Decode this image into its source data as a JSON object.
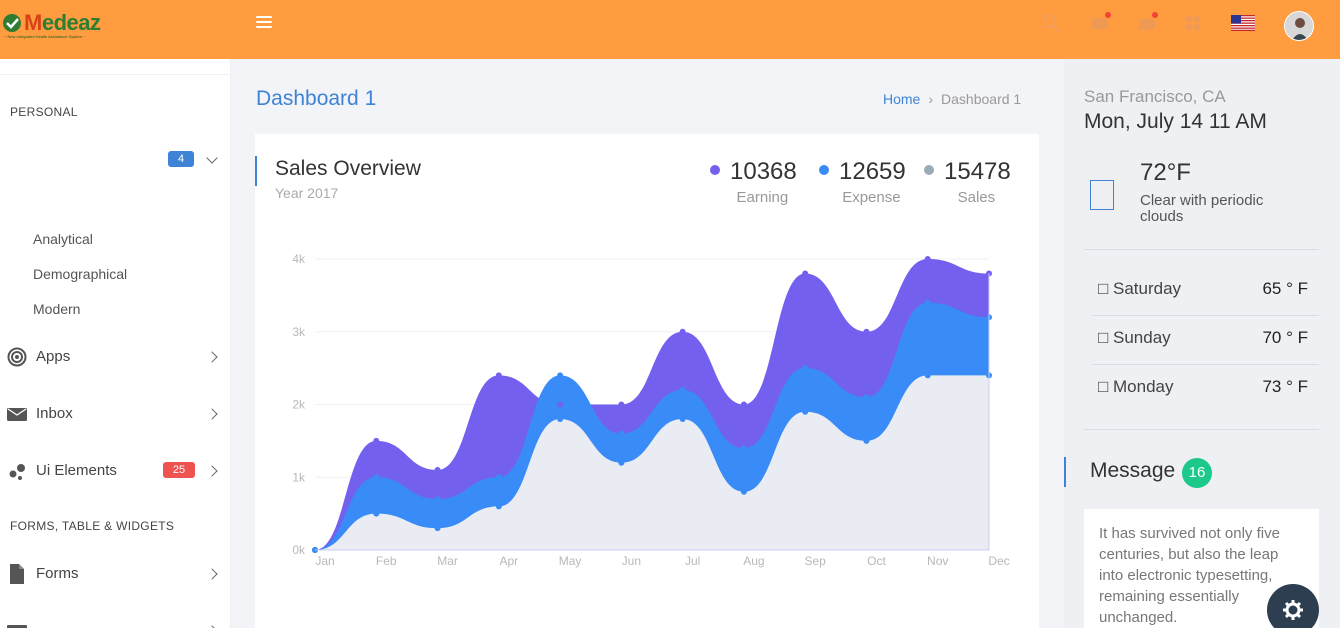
{
  "header": {
    "logo_text_1": "M",
    "logo_text_2": "edeaz",
    "logo_tagline": "~ New Integrated Health Assistance System ~",
    "icons": [
      "menu-icon",
      "search-icon",
      "notification-icon",
      "mail-icon",
      "grid-icon",
      "us-flag-icon",
      "user-avatar"
    ]
  },
  "sidebar": {
    "section_personal": "PERSONAL",
    "dashboard_badge": "4",
    "sub_items": [
      "Analytical",
      "Demographical",
      "Modern"
    ],
    "items": [
      {
        "label": "Apps",
        "icon": "target-icon"
      },
      {
        "label": "Inbox",
        "icon": "mail-icon"
      },
      {
        "label": "Ui Elements",
        "icon": "shapes-icon",
        "badge": "25"
      }
    ],
    "section_forms": "FORMS, TABLE & WIDGETS",
    "forms_item": {
      "label": "Forms",
      "icon": "document-icon"
    }
  },
  "page": {
    "title": "Dashboard 1",
    "breadcrumb_home": "Home",
    "breadcrumb_current": "Dashboard 1"
  },
  "sales": {
    "title": "Sales Overview",
    "subtitle": "Year 2017",
    "stats": [
      {
        "value": "10368",
        "label": "Earning",
        "color": "#7460ee"
      },
      {
        "value": "12659",
        "label": "Expense",
        "color": "#398bf7"
      },
      {
        "value": "15478",
        "label": "Sales",
        "color": "#99abb4"
      }
    ]
  },
  "chart_data": {
    "type": "area",
    "categories": [
      "Jan",
      "Feb",
      "Mar",
      "Apr",
      "May",
      "Jun",
      "Jul",
      "Aug",
      "Sep",
      "Oct",
      "Nov",
      "Dec"
    ],
    "yticks": [
      "0k",
      "1k",
      "2k",
      "3k",
      "4k"
    ],
    "ylim": [
      0,
      4000
    ],
    "series": [
      {
        "color": "#7460ee",
        "values": [
          0,
          1500,
          1100,
          2400,
          2000,
          2000,
          3000,
          2000,
          3800,
          3000,
          4000,
          3800
        ]
      },
      {
        "color": "#398bf7",
        "values": [
          0,
          1000,
          700,
          1000,
          2400,
          1600,
          2200,
          1400,
          2500,
          2100,
          3400,
          3200
        ]
      },
      {
        "color": "#e9ecf2",
        "values": [
          0,
          500,
          300,
          600,
          1800,
          1200,
          1800,
          800,
          1900,
          1500,
          2400,
          2400
        ]
      }
    ],
    "grid": true
  },
  "weather": {
    "location": "San Francisco, CA",
    "datetime": "Mon, July 14 11 AM",
    "temperature": "72°F",
    "condition": "Clear with periodic clouds",
    "forecast": [
      {
        "day": "Saturday",
        "temp": "65 ° F"
      },
      {
        "day": "Sunday",
        "temp": "70 ° F"
      },
      {
        "day": "Monday",
        "temp": "73 ° F"
      }
    ]
  },
  "messages": {
    "title": "Message",
    "count": "16",
    "preview": "It has survived not only five centuries, but also the leap into electronic typesetting, remaining essentially unchanged."
  }
}
